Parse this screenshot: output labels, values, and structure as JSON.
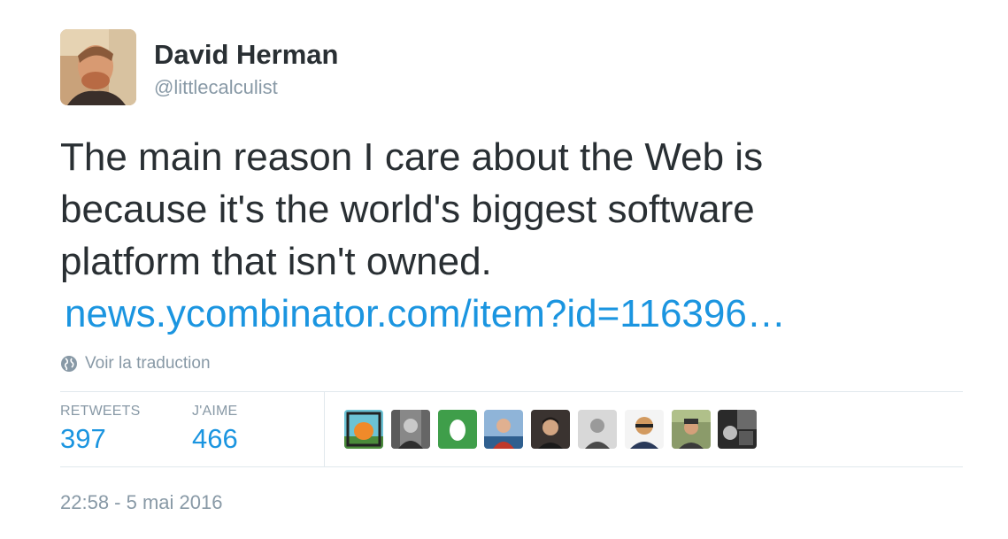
{
  "author": {
    "name": "David Herman",
    "handle": "@littlecalculist"
  },
  "tweet": {
    "lines": [
      "The main reason I care about the Web is",
      "because it's the world's biggest software",
      "platform that isn't owned."
    ],
    "link": "news.ycombinator.com/item?id=116396…"
  },
  "translate": {
    "label": "Voir la traduction",
    "icon": "globe-icon"
  },
  "stats": {
    "retweets_label": "RETWEETS",
    "retweets_value": "397",
    "likes_label": "J'AIME",
    "likes_value": "466"
  },
  "likers": [
    {
      "icon": "liker-avatar-drawing",
      "color": "#f08a2a"
    },
    {
      "icon": "liker-avatar-photo",
      "color": "#555555"
    },
    {
      "icon": "liker-avatar-egg",
      "color": "#3f9e4a"
    },
    {
      "icon": "liker-avatar-photo",
      "color": "#4a78a8"
    },
    {
      "icon": "liker-avatar-photo",
      "color": "#2e2a28"
    },
    {
      "icon": "liker-avatar-photo",
      "color": "#9a9a9a"
    },
    {
      "icon": "liker-avatar-photo",
      "color": "#d29a60"
    },
    {
      "icon": "liker-avatar-photo",
      "color": "#6f7d5a"
    },
    {
      "icon": "liker-avatar-photo",
      "color": "#444444"
    }
  ],
  "timestamp": "22:58 - 5 mai 2016",
  "colors": {
    "link": "#1b95e0",
    "text": "#292f33",
    "muted": "#8899a6",
    "divider": "#e1e8ed"
  }
}
